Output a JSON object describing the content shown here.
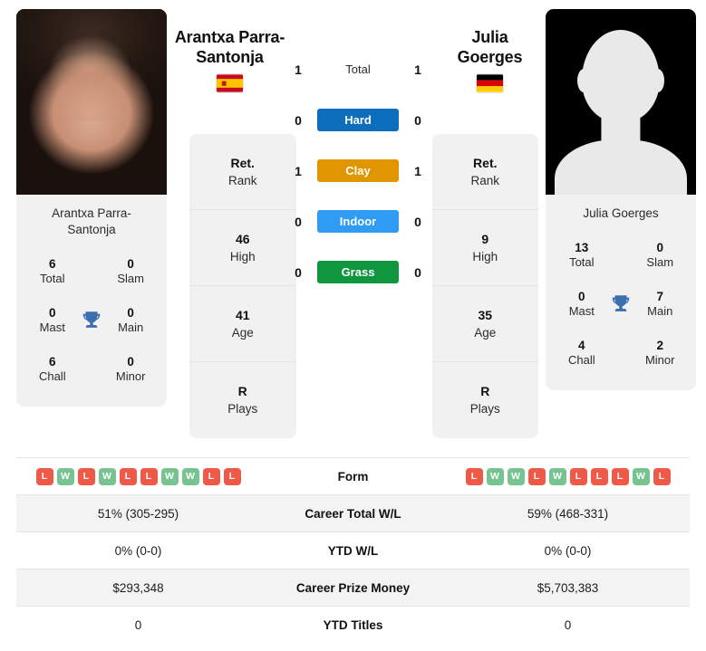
{
  "players": {
    "left": {
      "name": "Arantxa Parra-Santonja",
      "name_line1": "Arantxa Parra-",
      "name_line2": "Santonja",
      "card_name_line1": "Arantxa Parra-",
      "card_name_line2": "Santonja",
      "flag": "spain-flag",
      "photo": "player-photo",
      "titles": {
        "total_value": "6",
        "total_label": "Total",
        "slam_value": "0",
        "slam_label": "Slam",
        "mast_value": "0",
        "mast_label": "Mast",
        "main_value": "0",
        "main_label": "Main",
        "chall_value": "6",
        "chall_label": "Chall",
        "minor_value": "0",
        "minor_label": "Minor"
      },
      "info": [
        {
          "value": "Ret.",
          "label": "Rank"
        },
        {
          "value": "46",
          "label": "High"
        },
        {
          "value": "41",
          "label": "Age"
        },
        {
          "value": "R",
          "label": "Plays"
        }
      ],
      "form": [
        "L",
        "W",
        "L",
        "W",
        "L",
        "L",
        "W",
        "W",
        "L",
        "L"
      ],
      "career_total_wl": "51% (305-295)",
      "ytd_wl": "0% (0-0)",
      "career_prize_money": "$293,348",
      "ytd_titles": "0"
    },
    "right": {
      "name": "Julia Goerges",
      "name_line1": "Julia",
      "name_line2": "Goerges",
      "card_name_line1": "Julia Goerges",
      "card_name_line2": "",
      "flag": "germany-flag",
      "photo": "player-photo-placeholder",
      "titles": {
        "total_value": "13",
        "total_label": "Total",
        "slam_value": "0",
        "slam_label": "Slam",
        "mast_value": "0",
        "mast_label": "Mast",
        "main_value": "7",
        "main_label": "Main",
        "chall_value": "4",
        "chall_label": "Chall",
        "minor_value": "2",
        "minor_label": "Minor"
      },
      "info": [
        {
          "value": "Ret.",
          "label": "Rank"
        },
        {
          "value": "9",
          "label": "High"
        },
        {
          "value": "35",
          "label": "Age"
        },
        {
          "value": "R",
          "label": "Plays"
        }
      ],
      "form": [
        "L",
        "W",
        "W",
        "L",
        "W",
        "L",
        "L",
        "L",
        "W",
        "L"
      ],
      "career_total_wl": "59% (468-331)",
      "ytd_wl": "0% (0-0)",
      "career_prize_money": "$5,703,383",
      "ytd_titles": "0"
    }
  },
  "head_to_head": {
    "rows": [
      {
        "label": "Total",
        "left": "1",
        "right": "1",
        "color": "",
        "plain": true
      },
      {
        "label": "Hard",
        "left": "0",
        "right": "0",
        "color": "#0d6ebd",
        "plain": false
      },
      {
        "label": "Clay",
        "left": "1",
        "right": "1",
        "color": "#e09600",
        "plain": false
      },
      {
        "label": "Indoor",
        "left": "0",
        "right": "0",
        "color": "#2f9bf2",
        "plain": false
      },
      {
        "label": "Grass",
        "left": "0",
        "right": "0",
        "color": "#119640",
        "plain": false
      }
    ]
  },
  "comparison_table": {
    "rows": [
      {
        "key": "form",
        "label": "Form",
        "type": "form"
      },
      {
        "key": "ctwl",
        "label": "Career Total W/L",
        "type": "text"
      },
      {
        "key": "ytdwl",
        "label": "YTD W/L",
        "type": "text"
      },
      {
        "key": "prize",
        "label": "Career Prize Money",
        "type": "text"
      },
      {
        "key": "titles",
        "label": "YTD Titles",
        "type": "text"
      }
    ]
  },
  "colors": {
    "win_badge": "#77c491",
    "loss_badge": "#ef5a48",
    "trophy": "#3b6fb0",
    "card_bg": "#f1f1f1",
    "row_shade": "#f3f3f3"
  }
}
